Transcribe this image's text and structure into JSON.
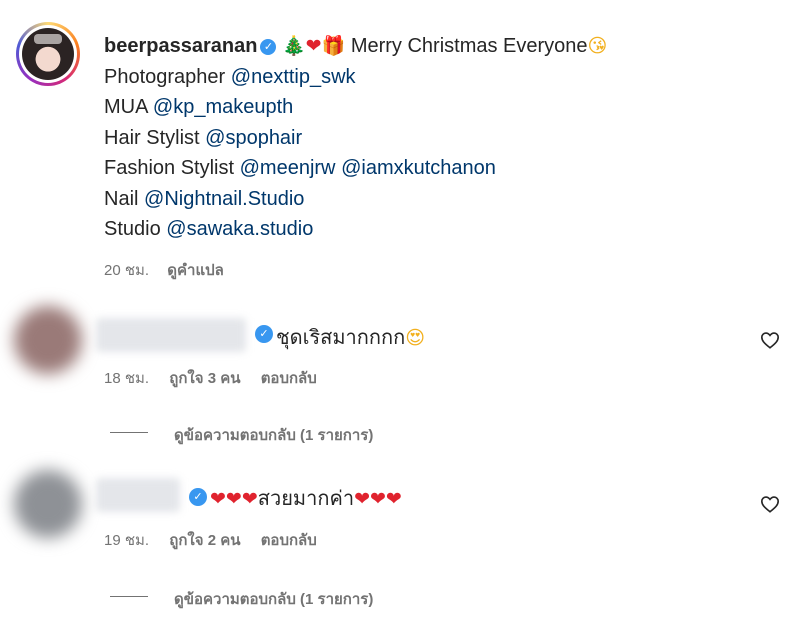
{
  "post": {
    "username": "beerpassaranan",
    "emojis": [
      "🎄",
      "❤",
      "🎁"
    ],
    "caption_text": "Merry Christmas Everyone",
    "caption_emoji": "😘",
    "credits": [
      {
        "role": "Photographer",
        "handles": [
          "@nexttip_swk"
        ]
      },
      {
        "role": "MUA",
        "handles": [
          "@kp_makeupth"
        ]
      },
      {
        "role": "Hair Stylist",
        "handles": [
          "@spophair"
        ]
      },
      {
        "role": "Fashion Stylist",
        "handles": [
          "@meenjrw",
          "@iamxkutchanon"
        ]
      },
      {
        "role": "Nail",
        "handles": [
          "@Nightnail.Studio"
        ]
      },
      {
        "role": "Studio",
        "handles": [
          "@sawaka.studio"
        ]
      }
    ],
    "time": "20 ชม.",
    "translate_label": "ดูคำแปล"
  },
  "comments": [
    {
      "text": "ชุดเริสมากกกก",
      "text_emoji": "😍",
      "time": "18 ชม.",
      "likes_label": "ถูกใจ 3 คน",
      "reply_label": "ตอบกลับ",
      "view_replies_label": "ดูข้อความตอบกลับ (1 รายการ)",
      "avatar_color": "#9a7a78"
    },
    {
      "text_prefix": "❤❤❤",
      "text": "สวยมากค่า",
      "text_suffix": "❤❤❤",
      "time": "19 ชม.",
      "likes_label": "ถูกใจ 2 คน",
      "reply_label": "ตอบกลับ",
      "view_replies_label": "ดูข้อความตอบกลับ (1 รายการ)",
      "avatar_color": "#8e9196"
    }
  ],
  "icons": {
    "verified": "verified-badge-icon",
    "like": "heart-outline-icon"
  },
  "colors": {
    "mention": "#00376b",
    "verified": "#3897f0",
    "meta": "#737373"
  }
}
